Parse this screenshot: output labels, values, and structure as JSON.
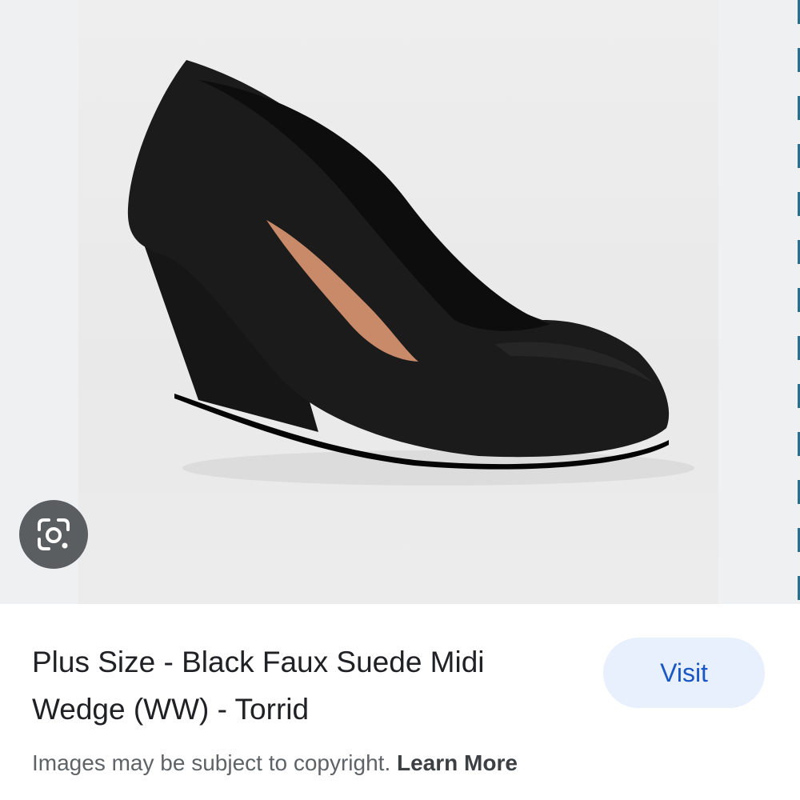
{
  "result": {
    "title": "Plus Size - Black Faux Suede Midi Wedge (WW) - Torrid",
    "visit_label": "Visit"
  },
  "footer": {
    "notice": "Images may be subject to copyright.",
    "learn_more": "Learn More"
  },
  "icons": {
    "lens": "google-lens-icon"
  },
  "colors": {
    "visit_bg": "#e8f0fe",
    "visit_text": "#1a56c4",
    "lens_bg": "#5b5e61",
    "title_text": "#202124",
    "notice_text": "#5f6368"
  }
}
